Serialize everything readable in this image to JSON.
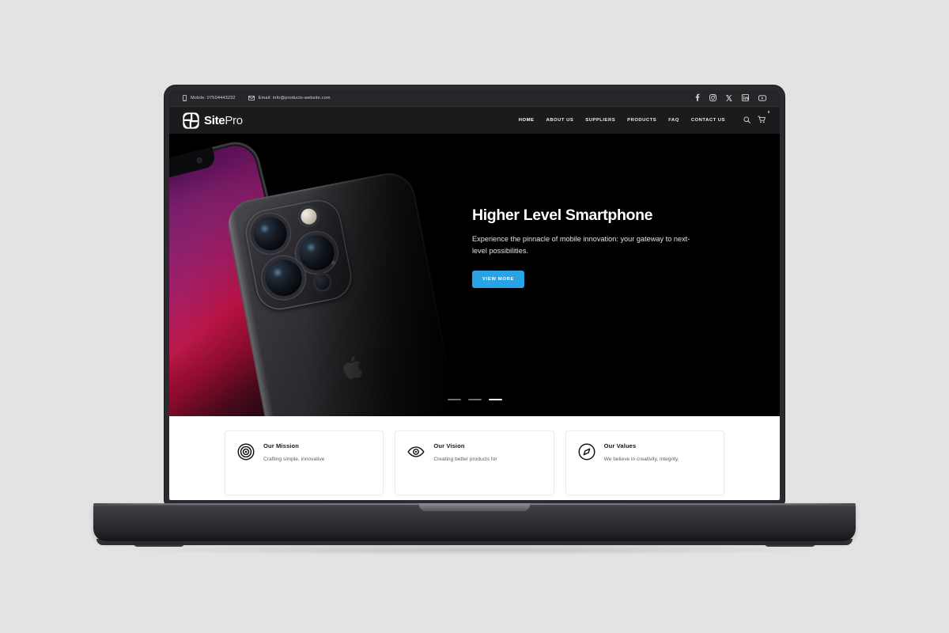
{
  "page": {
    "background_color": "#e3e3e3",
    "device": "macbook-pro-laptop-mockup"
  },
  "topbar": {
    "mobile_label": "Mobile: 07504443232",
    "email_label": "Email: info@products-website.com",
    "mobile_icon": "phone-icon",
    "email_icon": "envelope-icon",
    "social": [
      {
        "name": "facebook-icon",
        "label": "Facebook"
      },
      {
        "name": "instagram-icon",
        "label": "Instagram"
      },
      {
        "name": "x-twitter-icon",
        "label": "X"
      },
      {
        "name": "linkedin-icon",
        "label": "LinkedIn"
      },
      {
        "name": "youtube-icon",
        "label": "YouTube"
      }
    ],
    "background_color": "#262629"
  },
  "navbar": {
    "background_color": "#1b1b1e",
    "logo": {
      "mark": "pinwheel-square-logo-icon",
      "text_bold": "Site",
      "text_light": "Pro"
    },
    "links": [
      {
        "label": "HOME",
        "active": true
      },
      {
        "label": "ABOUT US",
        "active": false
      },
      {
        "label": "SUPPLIERS",
        "active": false
      },
      {
        "label": "PRODUCTS",
        "active": false
      },
      {
        "label": "FAQ",
        "active": false
      },
      {
        "label": "CONTACT US",
        "active": false
      }
    ],
    "search_icon": "search-icon",
    "cart_icon": "shopping-cart-icon",
    "cart_badge": "0"
  },
  "hero": {
    "background_color": "#000000",
    "title": "Higher Level Smartphone",
    "subtitle": "Experience the pinnacle of mobile innovation: your gateway to next-level possibilities.",
    "cta_label": "VIEW MORE",
    "cta_color": "#29a3e8",
    "image_alt": "two-smartphones-front-and-back",
    "carousel": {
      "slide_count": 3,
      "active_index": 3,
      "indicator_style": "dash"
    }
  },
  "features": {
    "background_color": "#ffffff",
    "cards": [
      {
        "icon": "target-bullseye-icon",
        "title": "Our Mission",
        "desc": "Crafting simple, innovative"
      },
      {
        "icon": "eye-icon",
        "title": "Our Vision",
        "desc": "Creating better products for"
      },
      {
        "icon": "compass-icon",
        "title": "Our Values",
        "desc": "We believe in creativity, integrity,"
      }
    ]
  }
}
